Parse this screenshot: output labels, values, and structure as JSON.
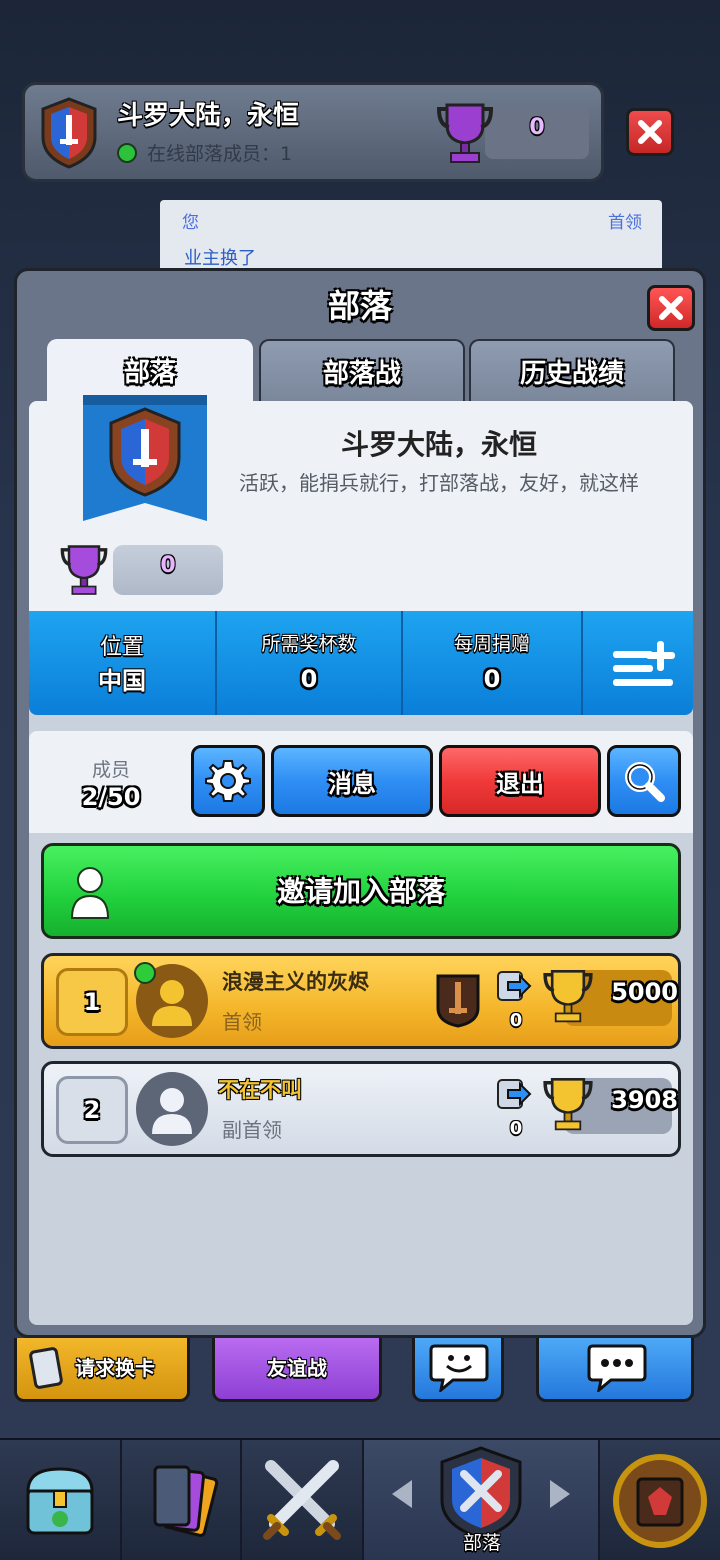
{
  "colors": {
    "accent_blue": "#1ea4f0",
    "invite_green": "#22d23e",
    "exit_red": "#f03a3a",
    "leader_gold": "#f4b52a",
    "online_green": "#2ec13b"
  },
  "top_header": {
    "clan_name": "斗罗大陆，永恒",
    "online_text": "在线部落成员：1",
    "trophy_value": "0"
  },
  "chat": {
    "sender": "您",
    "role": "首领",
    "message": "业主换了"
  },
  "panel": {
    "title": "部落",
    "tabs": [
      {
        "label": "部落",
        "active": true
      },
      {
        "label": "部落战",
        "active": false
      },
      {
        "label": "历史战绩",
        "active": false
      }
    ]
  },
  "clan": {
    "name": "斗罗大陆，永恒",
    "description": "活跃，能捐兵就行，打部落战，友好，就这样",
    "trophies": "0",
    "stats": [
      {
        "label": "位置",
        "value": "中国"
      },
      {
        "label": "所需奖杯数",
        "value": "0"
      },
      {
        "label": "每周捐赠",
        "value": "0"
      }
    ]
  },
  "members": {
    "label": "成员",
    "count": "2/50",
    "message_button": "消息",
    "exit_button": "退出",
    "invite_button": "邀请加入部落",
    "list": [
      {
        "rank": "1",
        "name": "浪漫主义的灰烬",
        "role": "首领",
        "donations": "0",
        "trophies": "5000",
        "online": true
      },
      {
        "rank": "2",
        "name": "不在不叫",
        "role": "副首领",
        "donations": "0",
        "trophies": "3908",
        "online": false
      }
    ]
  },
  "bottom_strip": {
    "request_label": "请求换卡",
    "friendly_label": "友谊战"
  },
  "nav": {
    "active_label": "部落"
  },
  "icons": [
    "clan-shield-icon",
    "trophy-icon",
    "close-icon",
    "gear-icon",
    "search-icon",
    "list-add-icon",
    "person-icon",
    "donate-icon",
    "chat-emote-icon",
    "chat-bubble-icon",
    "chest-icon",
    "cards-icon",
    "battle-swords-icon",
    "tournament-icon"
  ]
}
